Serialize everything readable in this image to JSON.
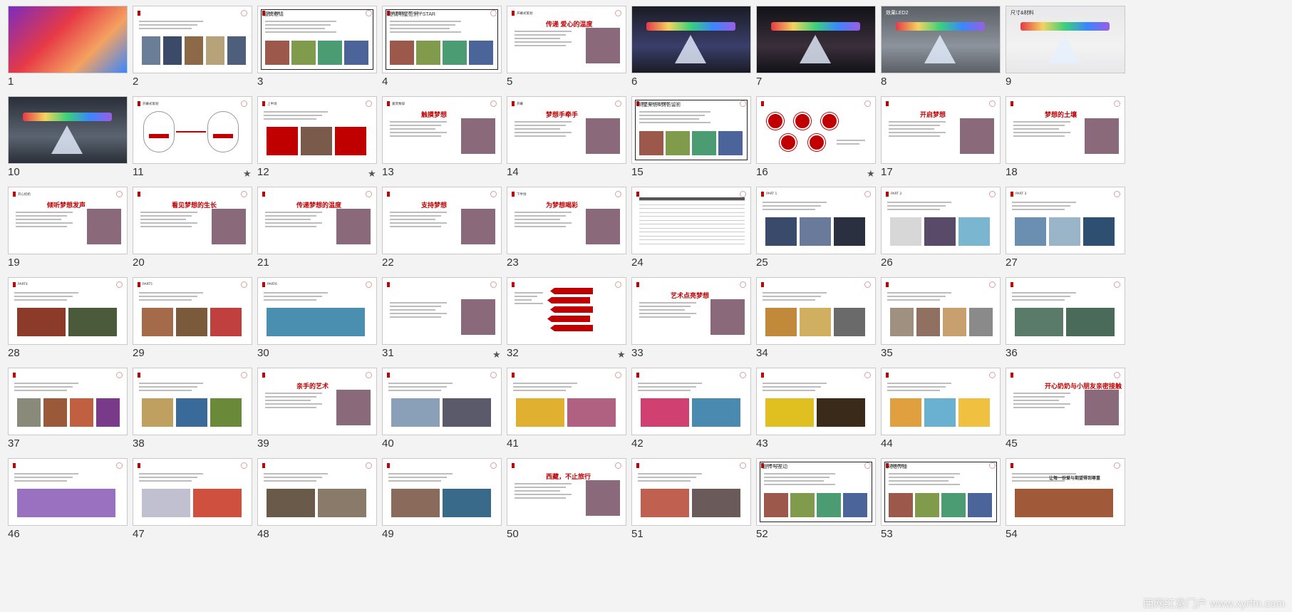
{
  "slides": [
    {
      "n": "1",
      "t": "c",
      "title": "",
      "title2": "",
      "sub": ""
    },
    {
      "n": "2",
      "t": "p",
      "h": "",
      "photos": [
        "#6a7f97",
        "#3c4a6a",
        "#8c6a48",
        "#b6a37a",
        "#4d5f7a"
      ]
    },
    {
      "n": "3",
      "t": "f",
      "h": "嘉宾邀请"
    },
    {
      "n": "4",
      "t": "f",
      "h": "邀请明星范例 / STAR"
    },
    {
      "n": "5",
      "t": "s",
      "h": "开幕式策划",
      "big": "传递 爱心的温度"
    },
    {
      "n": "6",
      "t": "r",
      "colors": [
        "#1b1b24",
        "#3a3f6b",
        "#e94b3c"
      ]
    },
    {
      "n": "7",
      "t": "r",
      "colors": [
        "#121218",
        "#3a2f3b",
        "#e9a13c"
      ]
    },
    {
      "n": "8",
      "t": "r",
      "colors": [
        "#5b5f66",
        "#8d939c",
        "#c6c9cf"
      ],
      "label": "效果LED2"
    },
    {
      "n": "9",
      "t": "r",
      "colors": [
        "#e8e8ea",
        "#f2f2f2",
        "#2f6fd8"
      ],
      "label": "尺寸&材料"
    },
    {
      "n": "10",
      "t": "r",
      "colors": [
        "#2a2f38",
        "#5a6470",
        "#37d27a"
      ]
    },
    {
      "n": "11",
      "t": "d",
      "h": "开幕式策划",
      "star": true
    },
    {
      "n": "12",
      "t": "p",
      "h": "上半场",
      "star": true,
      "photos": [
        "#c00000",
        "#7a5a4a",
        "#c00000"
      ]
    },
    {
      "n": "13",
      "t": "s",
      "h": "嘉宾致辞",
      "big": "触摸梦想"
    },
    {
      "n": "14",
      "t": "s",
      "h": "开幕",
      "big": "梦想手牵手"
    },
    {
      "n": "15",
      "t": "f",
      "h": "明星采访&到访留影"
    },
    {
      "n": "16",
      "t": "o",
      "star": true
    },
    {
      "n": "17",
      "t": "s",
      "h": "",
      "big": "开启梦想"
    },
    {
      "n": "18",
      "t": "s",
      "h": "",
      "big": "梦想的土壤"
    },
    {
      "n": "19",
      "t": "s",
      "h": "开心奶奶",
      "big": "倾听梦想发声"
    },
    {
      "n": "20",
      "t": "s",
      "h": "",
      "big": "看见梦想的生长"
    },
    {
      "n": "21",
      "t": "s",
      "h": "",
      "big": "传递梦想的温度"
    },
    {
      "n": "22",
      "t": "s",
      "h": "",
      "big": "支持梦想"
    },
    {
      "n": "23",
      "t": "s",
      "h": "下半场",
      "big": "为梦想喝彩"
    },
    {
      "n": "24",
      "t": "tb",
      "h": ""
    },
    {
      "n": "25",
      "t": "p",
      "h": "PART 1",
      "photos": [
        "#3a4a6a",
        "#6a7a9a",
        "#2a3040"
      ]
    },
    {
      "n": "26",
      "t": "p",
      "h": "PART 2",
      "photos": [
        "#d7d7d7",
        "#5a4a6a",
        "#7ab6d0"
      ]
    },
    {
      "n": "27",
      "t": "p",
      "h": "PART 3",
      "photos": [
        "#6a8fb0",
        "#9ab5c8",
        "#2f4f70"
      ]
    },
    {
      "n": "28",
      "t": "p",
      "h": "PART4",
      "photos": [
        "#8c3a2a",
        "#4a5a3a"
      ]
    },
    {
      "n": "29",
      "t": "p",
      "h": "PART5",
      "photos": [
        "#a56a4a",
        "#7a5a3a",
        "#c04040"
      ]
    },
    {
      "n": "30",
      "t": "p",
      "h": "PART6",
      "photos": [
        "#4a8fb0"
      ]
    },
    {
      "n": "31",
      "t": "s",
      "h": "",
      "star": true,
      "big": ""
    },
    {
      "n": "32",
      "t": "ar",
      "h": "",
      "star": true
    },
    {
      "n": "33",
      "t": "s",
      "h": "",
      "big": "艺术点亮梦想"
    },
    {
      "n": "34",
      "t": "p",
      "h": "",
      "photos": [
        "#c08a3a",
        "#d0b060",
        "#6a6a6a"
      ]
    },
    {
      "n": "35",
      "t": "p",
      "h": "",
      "photos": [
        "#a09080",
        "#907060",
        "#c8a070",
        "#8a8a8a"
      ]
    },
    {
      "n": "36",
      "t": "p",
      "h": "",
      "photos": [
        "#5a7a6a",
        "#4a6a5a"
      ]
    },
    {
      "n": "37",
      "t": "p",
      "h": "",
      "photos": [
        "#8a8a7a",
        "#9a5a3a",
        "#c06040",
        "#7a3a8a"
      ]
    },
    {
      "n": "38",
      "t": "p",
      "h": "",
      "photos": [
        "#c0a060",
        "#3a6a9a",
        "#6a8a3a"
      ]
    },
    {
      "n": "39",
      "t": "s",
      "h": "",
      "big": "亲手的艺术"
    },
    {
      "n": "40",
      "t": "p",
      "h": "",
      "photos": [
        "#8aa0b8",
        "#5a5a6a"
      ]
    },
    {
      "n": "41",
      "t": "p",
      "h": "",
      "photos": [
        "#e0b030",
        "#b06080"
      ]
    },
    {
      "n": "42",
      "t": "p",
      "h": "",
      "photos": [
        "#d04070",
        "#4a8ab0"
      ]
    },
    {
      "n": "43",
      "t": "p",
      "h": "",
      "photos": [
        "#e0c020",
        "#3a2a1a"
      ]
    },
    {
      "n": "44",
      "t": "p",
      "h": "",
      "photos": [
        "#e0a040",
        "#6ab0d0",
        "#f0c040"
      ]
    },
    {
      "n": "45",
      "t": "s",
      "h": "",
      "big": "开心奶奶与小朋友亲密接触"
    },
    {
      "n": "46",
      "t": "p",
      "h": "",
      "photos": [
        "#9a70c0"
      ]
    },
    {
      "n": "47",
      "t": "p",
      "h": "",
      "photos": [
        "#c0c0d0",
        "#d05040"
      ]
    },
    {
      "n": "48",
      "t": "p",
      "h": "",
      "photos": [
        "#6a5a4a",
        "#8a7a6a"
      ]
    },
    {
      "n": "49",
      "t": "p",
      "h": "",
      "photos": [
        "#8a6a5a",
        "#3a6a8a"
      ]
    },
    {
      "n": "50",
      "t": "s",
      "h": "",
      "big": "西藏，不止旅行"
    },
    {
      "n": "51",
      "t": "p",
      "h": "",
      "photos": [
        "#c06050",
        "#6a5a5a"
      ]
    },
    {
      "n": "52",
      "t": "f",
      "h": "宣传与互动"
    },
    {
      "n": "53",
      "t": "f",
      "h": "网络传播"
    },
    {
      "n": "54",
      "t": "p",
      "h": "",
      "photos": [
        "#a05a3a"
      ],
      "big": "让每一份爱与期望得到尊重"
    }
  ],
  "watermark": "西网红意门户 www.xyrfm.com"
}
